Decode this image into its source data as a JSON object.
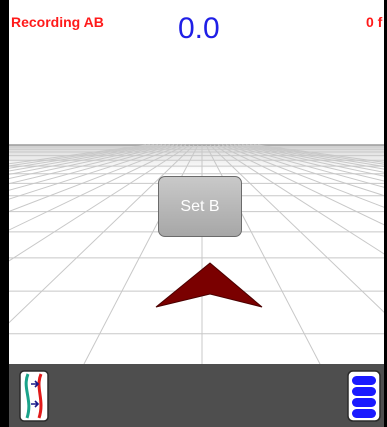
{
  "status": {
    "mode_text": "Recording AB",
    "value_text": "0.0",
    "right_text": "0 f"
  },
  "colors": {
    "status_text": "#ff1a1a",
    "value_text": "#1f1fe6",
    "arrow": "#7a0000",
    "toolbar": "#4e4e4e",
    "list_icon": "#1a1aff"
  },
  "main": {
    "set_b_label": "Set B"
  },
  "toolbar": {
    "left_icon": "ab-line-icon",
    "right_icon": "layers-list-icon"
  }
}
